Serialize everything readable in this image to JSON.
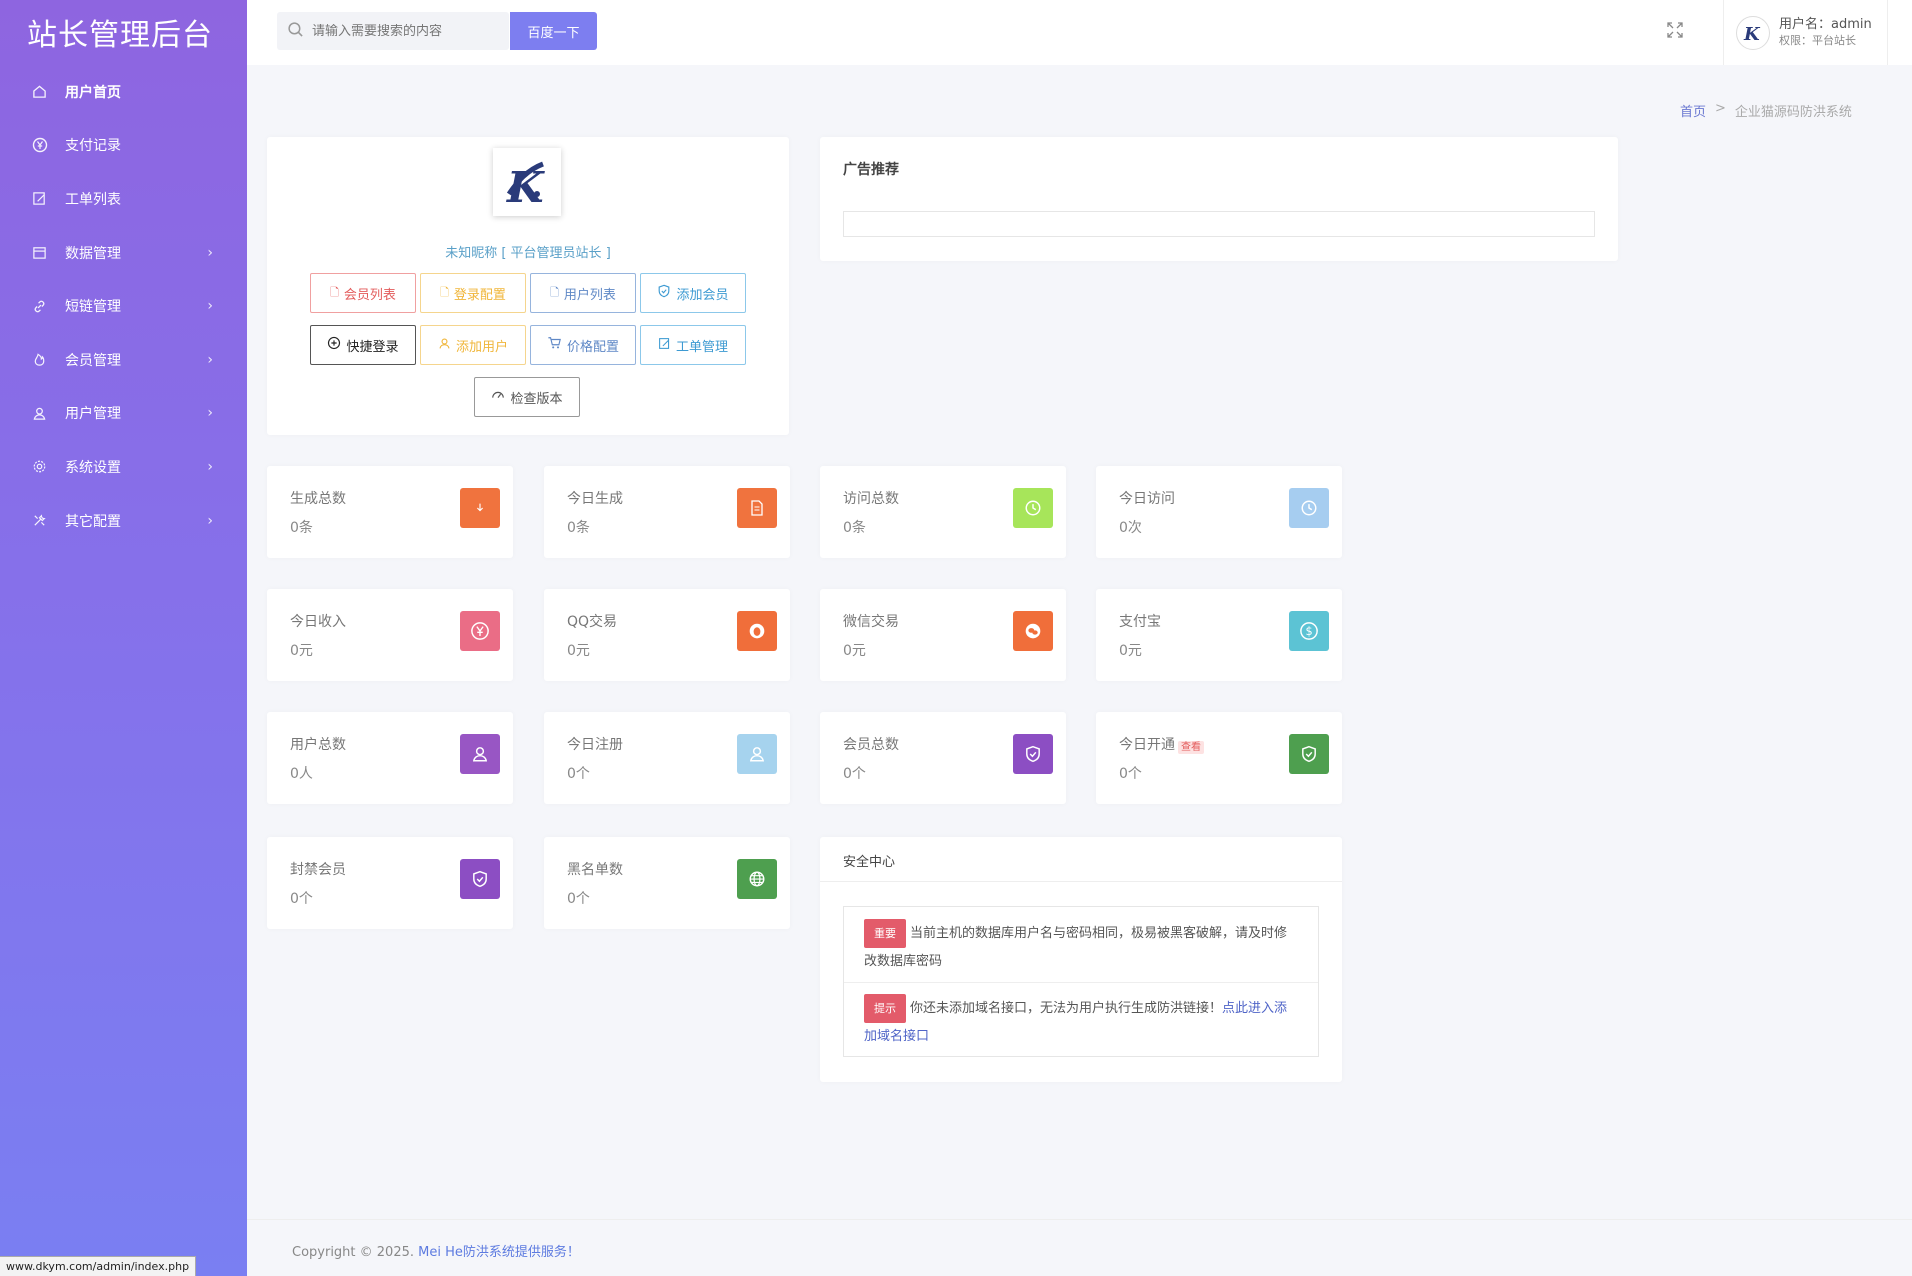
{
  "sidebar": {
    "brand": "站长管理后台",
    "items": [
      {
        "label": "用户首页",
        "icon": "home-icon",
        "has_sub": false
      },
      {
        "label": "支付记录",
        "icon": "yen-circle-icon",
        "has_sub": false
      },
      {
        "label": "工单列表",
        "icon": "edit-note-icon",
        "has_sub": false
      },
      {
        "label": "数据管理",
        "icon": "calendar-icon",
        "has_sub": true
      },
      {
        "label": "短链管理",
        "icon": "link-icon",
        "has_sub": true
      },
      {
        "label": "会员管理",
        "icon": "fire-icon",
        "has_sub": true
      },
      {
        "label": "用户管理",
        "icon": "user-icon",
        "has_sub": true
      },
      {
        "label": "系统设置",
        "icon": "gear-icon",
        "has_sub": true
      },
      {
        "label": "其它配置",
        "icon": "tools-icon",
        "has_sub": true
      }
    ]
  },
  "header": {
    "search_placeholder": "请输入需要搜索的内容",
    "search_button": "百度一下",
    "username_label": "用户名：admin",
    "role_label": "权限：平台站长"
  },
  "breadcrumb": {
    "home": "首页",
    "sep": ">",
    "current": "企业猫源码防洪系统"
  },
  "profile": {
    "nickname": "未知昵称 [ 平台管理员站长 ]",
    "buttons_row1": [
      "会员列表",
      "登录配置",
      "用户列表",
      "添加会员"
    ],
    "buttons_row2": [
      "快捷登录",
      "添加用户",
      "价格配置",
      "工单管理"
    ],
    "check_version": "检查版本"
  },
  "ad": {
    "title": "广告推荐"
  },
  "stats": [
    {
      "label": "生成总数",
      "value": "0条",
      "color": "#f0733e",
      "icon": "download-icon"
    },
    {
      "label": "今日生成",
      "value": "0条",
      "color": "#f0733e",
      "icon": "document-icon"
    },
    {
      "label": "访问总数",
      "value": "0条",
      "color": "#a7e55a",
      "icon": "clock-icon"
    },
    {
      "label": "今日访问",
      "value": "0次",
      "color": "#a6cdf0",
      "icon": "clock-icon"
    },
    {
      "label": "今日收入",
      "value": "0元",
      "color": "#ea6d86",
      "icon": "yen-circle-icon"
    },
    {
      "label": "QQ交易",
      "value": "0元",
      "color": "#f06e3a",
      "icon": "qq-icon"
    },
    {
      "label": "微信交易",
      "value": "0元",
      "color": "#f06e3a",
      "icon": "wechat-icon"
    },
    {
      "label": "支付宝",
      "value": "0元",
      "color": "#5cc3d4",
      "icon": "dollar-circle-icon"
    },
    {
      "label": "用户总数",
      "value": "0人",
      "color": "#9856c4",
      "icon": "user-icon"
    },
    {
      "label": "今日注册",
      "value": "0个",
      "color": "#a6d3ee",
      "icon": "user-icon"
    },
    {
      "label": "会员总数",
      "value": "0个",
      "color": "#8c4ec3",
      "icon": "shield-check-icon"
    },
    {
      "label": "今日开通",
      "value": "0个",
      "color": "#4e9f4f",
      "icon": "shield-check-icon",
      "tag": "查看"
    },
    {
      "label": "封禁会员",
      "value": "0个",
      "color": "#8c4ec3",
      "icon": "shield-check-icon"
    },
    {
      "label": "黑名单数",
      "value": "0个",
      "color": "#4e9f4f",
      "icon": "globe-icon"
    }
  ],
  "security": {
    "title": "安全中心",
    "items": [
      {
        "tag": "重要",
        "text": "当前主机的数据库用户名与密码相同，极易被黑客破解，请及时修改数据库密码",
        "link": ""
      },
      {
        "tag": "提示",
        "text": "你还未添加域名接口，无法为用户执行生成防洪链接！",
        "link": "点此进入添加域名接口"
      }
    ]
  },
  "footer": {
    "prefix": "Copyright © 2025.",
    "link": "Mei He防洪系统提供服务！"
  },
  "statusbar": {
    "url": "www.dkym.com/admin/index.php"
  }
}
